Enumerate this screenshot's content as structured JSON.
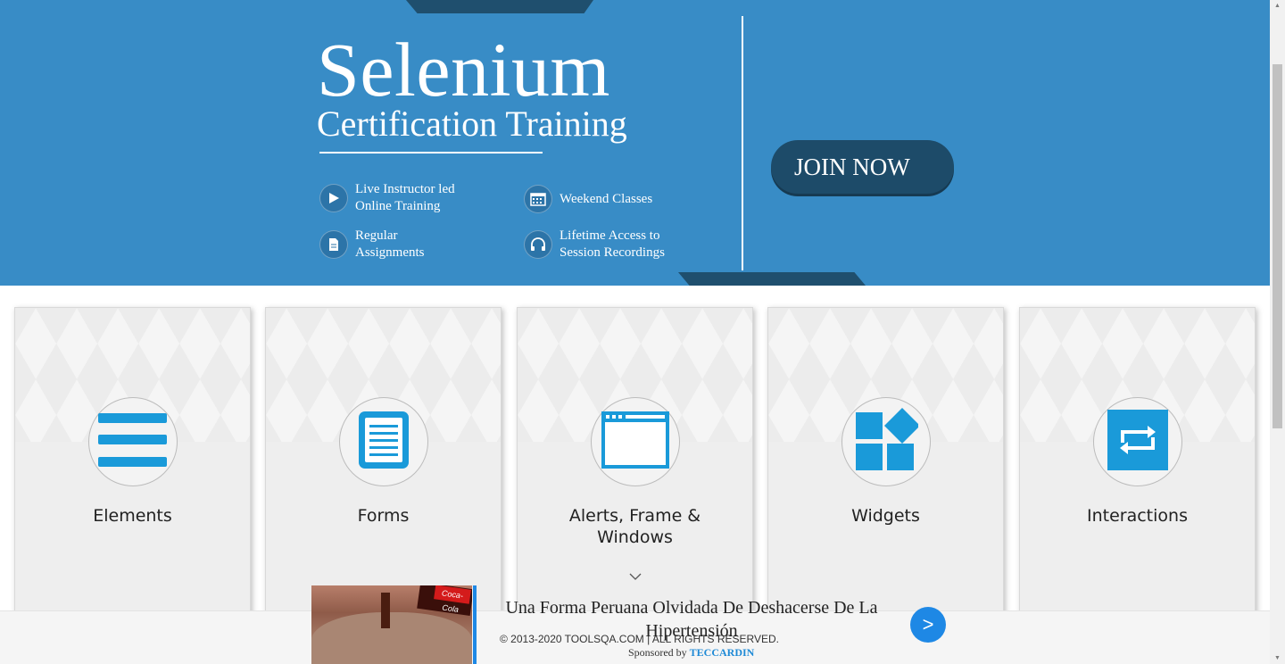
{
  "banner": {
    "title": "Selenium",
    "subtitle": "Certification Training",
    "features": [
      {
        "label": "Live Instructor led\nOnline Training",
        "icon": "play-icon"
      },
      {
        "label": "Weekend Classes",
        "icon": "calendar-icon"
      },
      {
        "label": "Regular\nAssignments",
        "icon": "document-icon"
      },
      {
        "label": "Lifetime Access to\nSession Recordings",
        "icon": "headphones-icon"
      }
    ],
    "join_label": "JOIN NOW"
  },
  "cards": [
    {
      "title": "Elements",
      "icon": "list-icon"
    },
    {
      "title": "Forms",
      "icon": "form-icon"
    },
    {
      "title": "Alerts, Frame &\nWindows",
      "icon": "window-icon"
    },
    {
      "title": "Widgets",
      "icon": "widgets-icon"
    },
    {
      "title": "Interactions",
      "icon": "interactions-icon"
    }
  ],
  "footer": {
    "copyright": "© 2013-2020 TOOLSQA.COM | ALL RIGHTS RESERVED.",
    "sponsor_prefix": "Sponsored by ",
    "sponsor_name": "TECCARDIN"
  },
  "ad": {
    "headline": "Una Forma Peruana Olvidada De Deshacerse De La Hipertensión",
    "next_label": ">",
    "image_label": "Coca-Cola"
  },
  "colors": {
    "banner_bg": "#388cc6",
    "banner_dark": "#1d4b69",
    "icon_blue": "#1a9ad9",
    "card_bg": "#eeeeee",
    "ad_blue": "#1e88e5"
  }
}
